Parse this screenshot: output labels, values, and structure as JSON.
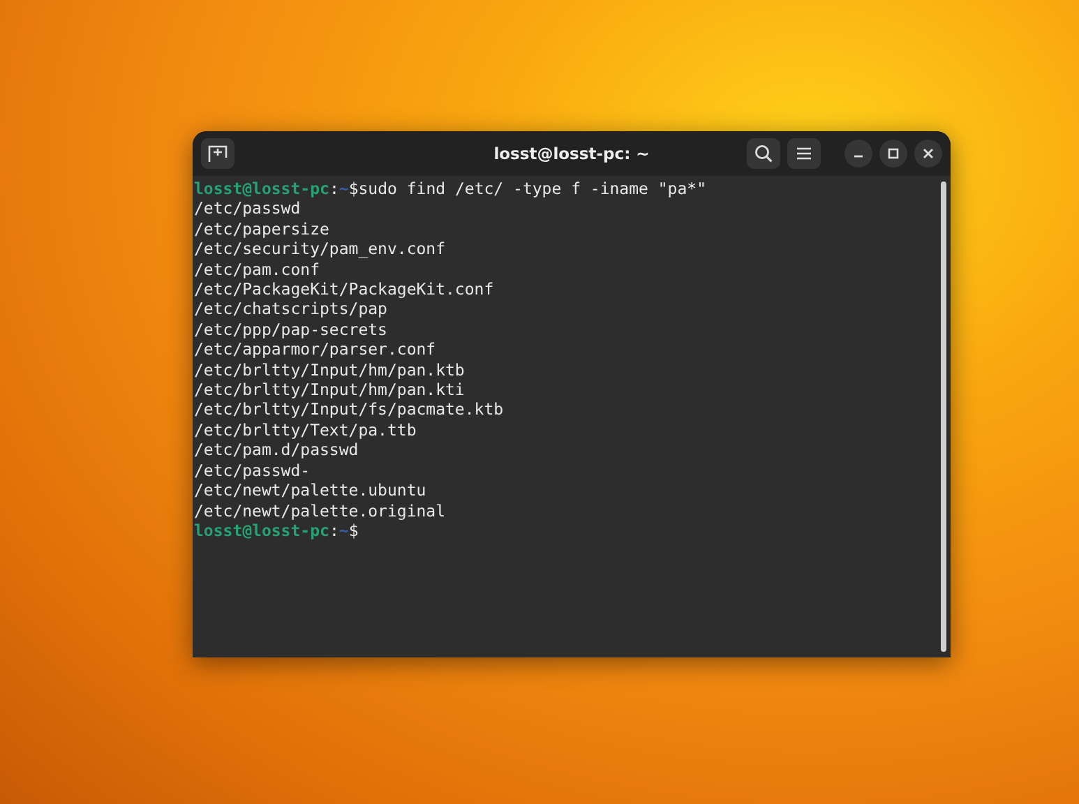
{
  "window": {
    "title": "losst@losst-pc: ~"
  },
  "terminal": {
    "lines": [
      {
        "kind": "prompt",
        "user": "losst@losst-pc",
        "separator": ":",
        "path": "~",
        "symbol": "$",
        "command": "sudo find /etc/ -type f -iname \"pa*\""
      },
      {
        "kind": "output",
        "text": "/etc/passwd"
      },
      {
        "kind": "output",
        "text": "/etc/papersize"
      },
      {
        "kind": "output",
        "text": "/etc/security/pam_env.conf"
      },
      {
        "kind": "output",
        "text": "/etc/pam.conf"
      },
      {
        "kind": "output",
        "text": "/etc/PackageKit/PackageKit.conf"
      },
      {
        "kind": "output",
        "text": "/etc/chatscripts/pap"
      },
      {
        "kind": "output",
        "text": "/etc/ppp/pap-secrets"
      },
      {
        "kind": "output",
        "text": "/etc/apparmor/parser.conf"
      },
      {
        "kind": "output",
        "text": "/etc/brltty/Input/hm/pan.ktb"
      },
      {
        "kind": "output",
        "text": "/etc/brltty/Input/hm/pan.kti"
      },
      {
        "kind": "output",
        "text": "/etc/brltty/Input/fs/pacmate.ktb"
      },
      {
        "kind": "output",
        "text": "/etc/brltty/Text/pa.ttb"
      },
      {
        "kind": "output",
        "text": "/etc/pam.d/passwd"
      },
      {
        "kind": "output",
        "text": "/etc/passwd-"
      },
      {
        "kind": "output",
        "text": "/etc/newt/palette.ubuntu"
      },
      {
        "kind": "output",
        "text": "/etc/newt/palette.original"
      },
      {
        "kind": "prompt",
        "user": "losst@losst-pc",
        "separator": ":",
        "path": "~",
        "symbol": "$"
      }
    ]
  }
}
